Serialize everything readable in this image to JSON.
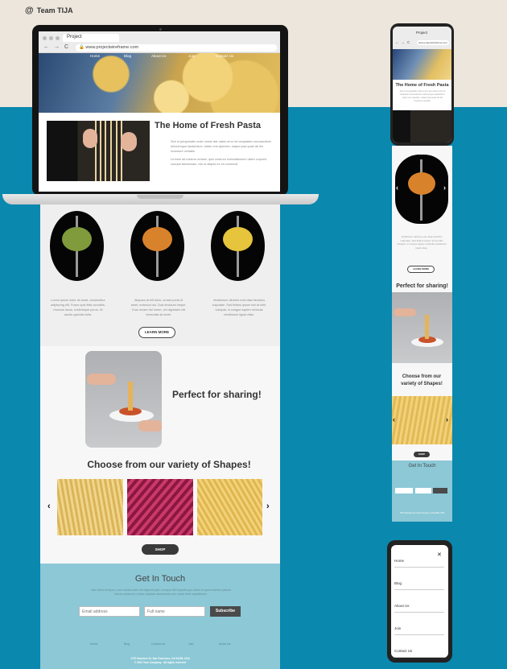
{
  "brand": {
    "symbol": "@",
    "name": "Team TIJA"
  },
  "browser": {
    "tab_title": "Project",
    "url": "www.projectwireframe.com",
    "nav_glyphs": "←→C"
  },
  "site_nav": [
    "Home",
    "Blog",
    "About Us",
    "Join",
    "Contact Us"
  ],
  "home": {
    "title": "The Home of Fresh Pasta",
    "paragraph_1": "Sed ut perspiciatis unde omnis iste natus error sit voluptatem accusantium doloremque laudantium, totam rem aperiam, eaque ipsa quae ab illo inventore veritatis.",
    "paragraph_2": "Ut enim ad minima veniam, quis nostrum exercitationem ullam corporis suscipit laboriosam, nisi ut aliquid ex ea commodi."
  },
  "columns": [
    {
      "text": "Lorem ipsum dolor sit amet, consectetur adipiscing elit. Fusce quis felis convallis, rhoncus lacus, scelerisque purus. Ut auctor gravida nulla."
    },
    {
      "text": "Aliquam at elit dolor, ornare porta id amet, euismod dui. Duis tincidunt neque. Cras ornare dui lorem, vel dignissim elit venenatis sit amet."
    },
    {
      "text": "Vestibulum ultricies erat vitae faucibus vulputate. Sed finibus ipsum nisi at nibh volutpat, in congue sapien vehicula vestibulum ligula vitae."
    }
  ],
  "learn_more": "LEARN MORE",
  "share_title": "Perfect for sharing!",
  "shapes_title": "Choose from our variety of Shapes!",
  "shapes_title_mobile": "Choose from our variety of Shapes!",
  "shop_label": "SHOP",
  "arrows": {
    "left": "‹",
    "right": "›"
  },
  "contact": {
    "title": "Get In Touch",
    "text": "Nam libero tempore, cum soluta nobis est eligendi optio cumque nihil impedit quo minus id quod maxime placeat facere possimus, omnis voluptas assumenda est, omnis dolor repellendus.",
    "email_placeholder": "Email address",
    "name_placeholder": "Full name",
    "subscribe": "Subscribe"
  },
  "footer_links": [
    "Home",
    "Blog",
    "Contact Us",
    "Join",
    "About Us"
  ],
  "footer_address": "1757 Nowhere St, San Francisco, CA 94105, USA",
  "footer_copyright": "© 2021 Your Company · All rights reserved",
  "mobile_menu": {
    "close": "✕",
    "items": [
      "Home",
      "Blog",
      "About Us",
      "Join",
      "Contact Us"
    ]
  }
}
